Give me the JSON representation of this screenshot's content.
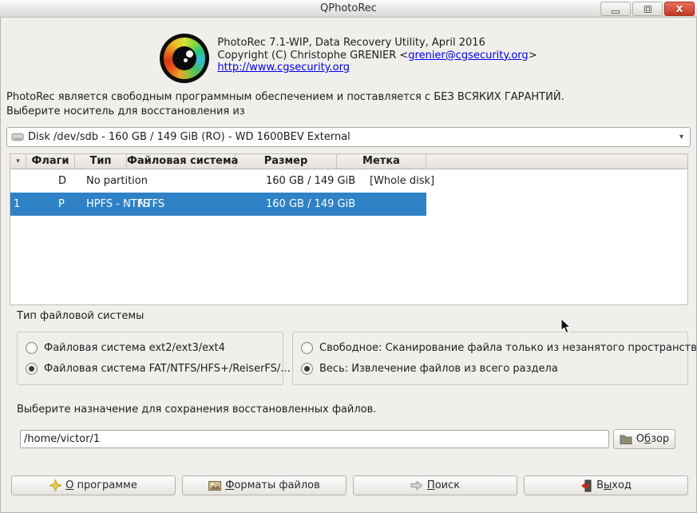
{
  "window": {
    "title": "QPhotoRec"
  },
  "icons": {
    "dropdown_arrow": "▾",
    "sort_arrow": "▾",
    "close_glyph": "X"
  },
  "brand": {
    "line1": "PhotoRec 7.1-WIP, Data Recovery Utility, April 2016",
    "copyright_prefix": "Copyright (C) Christophe GRENIER <",
    "email_link": "grenier@cgsecurity.org",
    "copyright_suffix": ">",
    "website_link": "http://www.cgsecurity.org"
  },
  "license_note": "PhotoRec является свободным программным обеспечением и поставляется с БЕЗ ВСЯКИХ ГАРАНТИЙ.",
  "media": {
    "label": "Выберите носитель для восстановления из",
    "selected_disk": "Disk /dev/sdb - 160 GB / 149 GiB (RO) - WD 1600BEV External"
  },
  "partition_table": {
    "headers": {
      "flags": "Флаги",
      "type": "Тип",
      "filesystem": "Файловая система",
      "size": "Размер",
      "label": "Метка"
    },
    "rows": [
      {
        "num": "",
        "flags": "D",
        "type": "No partition",
        "filesystem": "",
        "size": "160 GB / 149 GiB",
        "label": "[Whole disk]",
        "selected": false
      },
      {
        "num": "1",
        "flags": "P",
        "type": "HPFS - NTFS",
        "filesystem": "NTFS",
        "size": "160 GB / 149 GiB",
        "label": "",
        "selected": true
      }
    ]
  },
  "fs_type": {
    "label": "Тип файловой системы",
    "left_options": [
      {
        "label": "Файловая система ext2/ext3/ext4",
        "checked": false
      },
      {
        "label": "Файловая система FAT/NTFS/HFS+/ReiserFS/...",
        "checked": true
      }
    ],
    "right_options": [
      {
        "label": "Свободное: Сканирование файла только из незанятого пространства",
        "checked": false
      },
      {
        "label": "Весь: Извлечение файлов из всего раздела",
        "checked": true
      }
    ]
  },
  "destination": {
    "label": "Выберите назначение для сохранения восстановленных файлов.",
    "path": "/home/victor/1",
    "browse": {
      "pre": "О",
      "key": "б",
      "rest": "зор"
    }
  },
  "actions": {
    "about": {
      "pre": "",
      "key": "О",
      "rest": " программе"
    },
    "formats": {
      "pre": "",
      "key": "Ф",
      "rest": "орматы файлов"
    },
    "search": {
      "pre": "",
      "key": "П",
      "rest": "оиск"
    },
    "quit": {
      "pre": "В",
      "key": "ы",
      "rest": "ход"
    }
  },
  "colors": {
    "selection_blue": "#2e82c5",
    "link_blue": "#0000ee",
    "close_red": "#c23a26",
    "window_bg": "#f1efec"
  }
}
